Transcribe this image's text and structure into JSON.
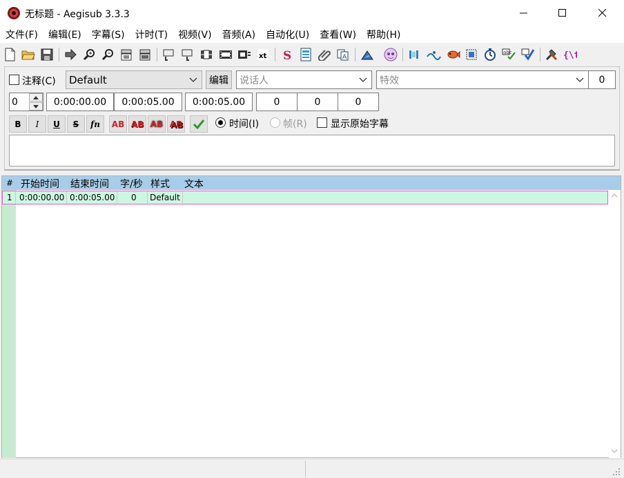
{
  "window": {
    "title": "无标题 - Aegisub 3.3.3",
    "app_icon": "aegisub-logo-icon"
  },
  "menu": [
    "文件(F)",
    "编辑(E)",
    "字幕(S)",
    "计时(T)",
    "视频(V)",
    "音频(A)",
    "自动化(U)",
    "查看(W)",
    "帮助(H)"
  ],
  "toolbar": {
    "icons": [
      "new-file-icon",
      "open-file-icon",
      "save-icon",
      "jump-to-icon",
      "zoom-in-icon",
      "zoom-out-icon",
      "snapshot-icon",
      "snapshot-clipboard-icon",
      "jump-video-start-icon",
      "jump-video-end-icon",
      "video-properties-icon",
      "video-frame-icon",
      "video-details-icon",
      "translation-assistant-icon",
      "styles-manager-icon",
      "properties-icon",
      "attachments-icon",
      "fonts-collector-icon",
      "resample-icon",
      "automation-icon",
      "kanji-timer-icon",
      "shift-times-icon",
      "timing-postprocessor-icon",
      "spellcheck-icon",
      "visual-typesetting-icon",
      "clock-icon",
      "select-lines-icon",
      "check-icon",
      "options-icon",
      "tag-hiding-icon"
    ]
  },
  "editbox": {
    "comment_label": "注释(C)",
    "comment_checked": false,
    "style_value": "Default",
    "edit_style_label": "编辑",
    "actor_placeholder": "说话人",
    "effect_placeholder": "特效",
    "layer_right": "0",
    "layer": "0",
    "start_time": "0:00:00.00",
    "end_time": "0:00:05.00",
    "duration": "0:00:05.00",
    "margin_left": "0",
    "margin_right": "0",
    "margin_vert": "0",
    "format_buttons": {
      "bold": "B",
      "italic": "I",
      "underline": "U",
      "strike": "S",
      "font": "fn",
      "color1": "AB",
      "color2": "AB",
      "color3": "AB",
      "color4": "AB"
    },
    "commit_icon": "checkmark-icon",
    "radio_time_label": "时间(I)",
    "radio_frame_label": "帧(R)",
    "time_selected": true,
    "show_original_label": "显示原始字幕",
    "show_original_checked": false,
    "text": ""
  },
  "grid": {
    "headers": [
      "#",
      "开始时间",
      "结束时间",
      "字/秒",
      "样式",
      "文本"
    ],
    "rows": [
      {
        "num": "1",
        "start": "0:00:00.00",
        "end": "0:00:05.00",
        "cps": "0",
        "style": "Default",
        "text": ""
      }
    ]
  },
  "colors": {
    "grid_header": "#a8cde8",
    "row_selected": "#cdf7e2",
    "row_border": "#e060c8",
    "rownum_bg": "#c7ebd0"
  }
}
